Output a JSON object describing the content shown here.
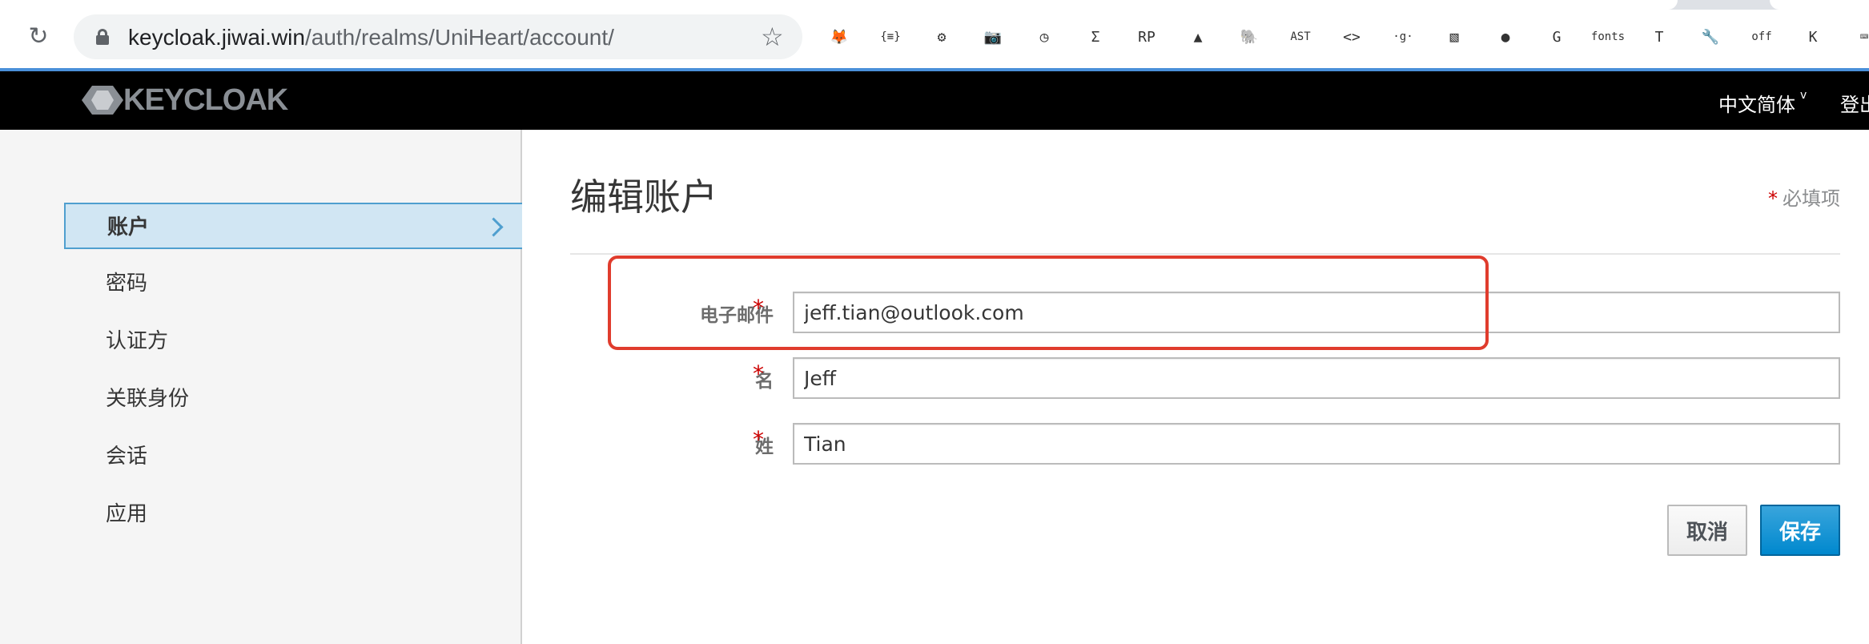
{
  "browser": {
    "url_host": "keycloak.jiwai.win",
    "url_path": "/auth/realms/UniHeart/account/",
    "extensions": [
      {
        "name": "metamask-fox-icon",
        "glyph": "🦊"
      },
      {
        "name": "json-formatter-icon",
        "glyph": "{≡}"
      },
      {
        "name": "network-tree-icon",
        "glyph": "⚙"
      },
      {
        "name": "camera-icon",
        "glyph": "📷"
      },
      {
        "name": "clock-check-icon",
        "glyph": "◷"
      },
      {
        "name": "sigma-icon",
        "glyph": "Σ"
      },
      {
        "name": "rp-icon",
        "glyph": "RP"
      },
      {
        "name": "lighthouse-icon",
        "glyph": "▲"
      },
      {
        "name": "elephant-icon",
        "glyph": "🐘"
      },
      {
        "name": "ast-icon",
        "glyph": "AST"
      },
      {
        "name": "code-brackets-icon",
        "glyph": "<>"
      },
      {
        "name": "g-icon",
        "glyph": "·g·"
      },
      {
        "name": "pattern-icon",
        "glyph": "▧"
      },
      {
        "name": "github-icon",
        "glyph": "●"
      },
      {
        "name": "g-orange-icon",
        "glyph": "G"
      },
      {
        "name": "fonts-icon",
        "glyph": "fonts"
      },
      {
        "name": "t-circle-icon",
        "glyph": "T"
      },
      {
        "name": "wrench-icon",
        "glyph": "🔧"
      },
      {
        "name": "off-badge-icon",
        "glyph": "off"
      },
      {
        "name": "k-orange-icon",
        "glyph": "K"
      },
      {
        "name": "keyboard-icon",
        "glyph": "⌨"
      }
    ]
  },
  "header": {
    "logo_text": "KEYCLOAK",
    "language": "中文简体",
    "language_caret": "v",
    "logout": "登出"
  },
  "sidebar": {
    "items": [
      {
        "label": "账户",
        "active": true
      },
      {
        "label": "密码",
        "active": false
      },
      {
        "label": "认证方",
        "active": false
      },
      {
        "label": "关联身份",
        "active": false
      },
      {
        "label": "会话",
        "active": false
      },
      {
        "label": "应用",
        "active": false
      }
    ]
  },
  "main": {
    "title": "编辑账户",
    "required_star": "*",
    "required_note": "必填项",
    "fields": [
      {
        "label": "电子邮件",
        "star": "*",
        "value": "jeff.tian@outlook.com"
      },
      {
        "label": "名",
        "star": "*",
        "value": "Jeff"
      },
      {
        "label": "姓",
        "star": "*",
        "value": "Tian"
      }
    ],
    "cancel_label": "取消",
    "save_label": "保存"
  },
  "colors": {
    "highlight": "#e03c2d",
    "primary": "#0088ce",
    "header_bg": "#000000",
    "sidebar_active_bg": "#d1e6f3"
  }
}
